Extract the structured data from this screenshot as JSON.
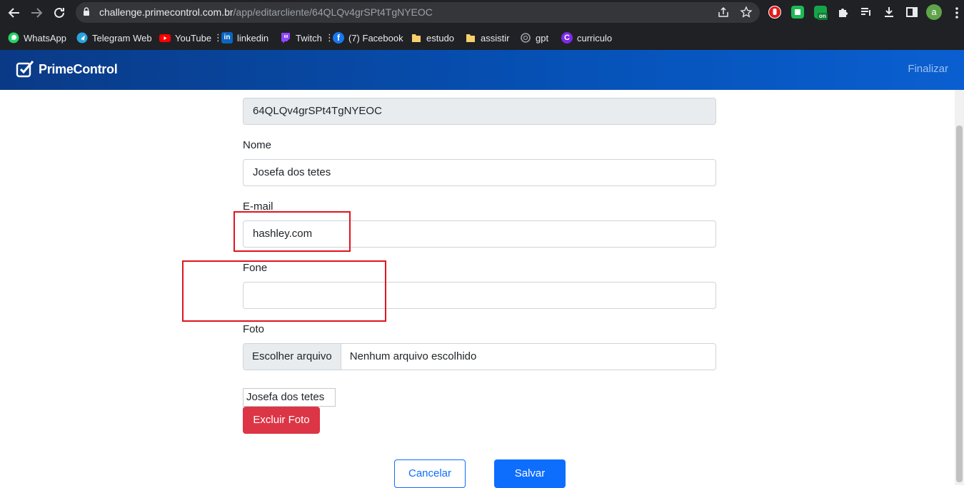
{
  "browser": {
    "url_host": "challenge.primecontrol.com.br",
    "url_path": "/app/editarcliente/64QLQv4grSPt4TgNYEOC",
    "profile_initial": "a",
    "extension_badge": "on",
    "bookmarks": [
      {
        "label": "WhatsApp",
        "icon": "whatsapp-icon",
        "color": "#25d366"
      },
      {
        "label": "Telegram Web",
        "icon": "telegram-icon",
        "color": "#2aa3df"
      },
      {
        "label": "YouTube",
        "icon": "youtube-icon",
        "color": "#ff0000"
      },
      {
        "label": "linkedin",
        "icon": "linkedin-icon",
        "color": "#0a66c2"
      },
      {
        "label": "Twitch",
        "icon": "twitch-icon",
        "color": "#9146ff"
      },
      {
        "label": "(7) Facebook",
        "icon": "facebook-icon",
        "color": "#1877f2"
      },
      {
        "label": "estudo",
        "icon": "folder-icon",
        "color": "#f6d06c"
      },
      {
        "label": "assistir",
        "icon": "folder-icon",
        "color": "#f6d06c"
      },
      {
        "label": "gpt",
        "icon": "openai-icon",
        "color": "#9aa0a6"
      },
      {
        "label": "curriculo",
        "icon": "canva-icon",
        "color": "#7d2ae8"
      }
    ]
  },
  "app": {
    "brand": "PrimeControl",
    "finalizar": "Finalizar"
  },
  "form": {
    "id_value": "64QLQv4grSPt4TgNYEOC",
    "nome_label": "Nome",
    "nome_value": "Josefa dos tetes",
    "email_label": "E-mail",
    "email_value": "hashley.com",
    "fone_label": "Fone",
    "fone_value": "",
    "foto_label": "Foto",
    "file_button": "Escolher arquivo",
    "file_status": "Nenhum arquivo escolhido",
    "photo_alt": "Josefa dos tetes",
    "delete_photo": "Excluir Foto",
    "cancel": "Cancelar",
    "save": "Salvar"
  },
  "colors": {
    "header": "#0652b8",
    "primary": "#0d6efd",
    "danger": "#dc3545",
    "annotation": "#e0141e"
  }
}
